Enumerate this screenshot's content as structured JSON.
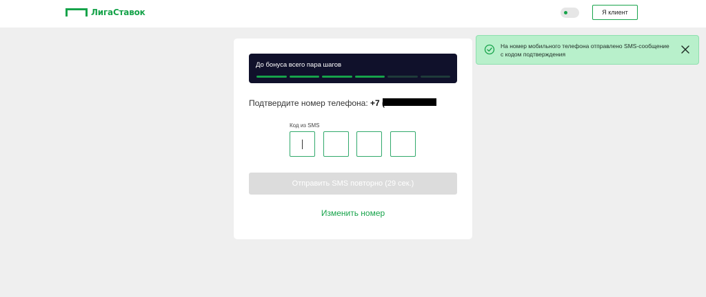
{
  "header": {
    "logo_text": "ЛигаСтавок",
    "client_button": "Я клиент",
    "theme_toggle_icon": "theme-toggle-icon"
  },
  "bonus": {
    "title": "До бонуса всего пара шагов",
    "steps_total": 6,
    "steps_completed": 4
  },
  "confirm": {
    "label": "Подтвердите номер телефона:",
    "phone_prefix": "+7 (9"
  },
  "sms": {
    "code_label": "Код из SMS",
    "digits": [
      "",
      "",
      "",
      ""
    ]
  },
  "actions": {
    "resend_label": "Отправить SMS повторно (29 сек.)",
    "change_number": "Изменить номер"
  },
  "toast": {
    "message": "На номер мобильного телефона отправлено SMS-сообщение с кодом подтверждения",
    "icon": "check-circle-icon",
    "close_icon": "close-icon"
  },
  "colors": {
    "brand": "#16a34a",
    "bonus_bg": "#10112b",
    "toast_bg": "#b8f0cb",
    "disabled_btn": "#dcdcdc"
  }
}
